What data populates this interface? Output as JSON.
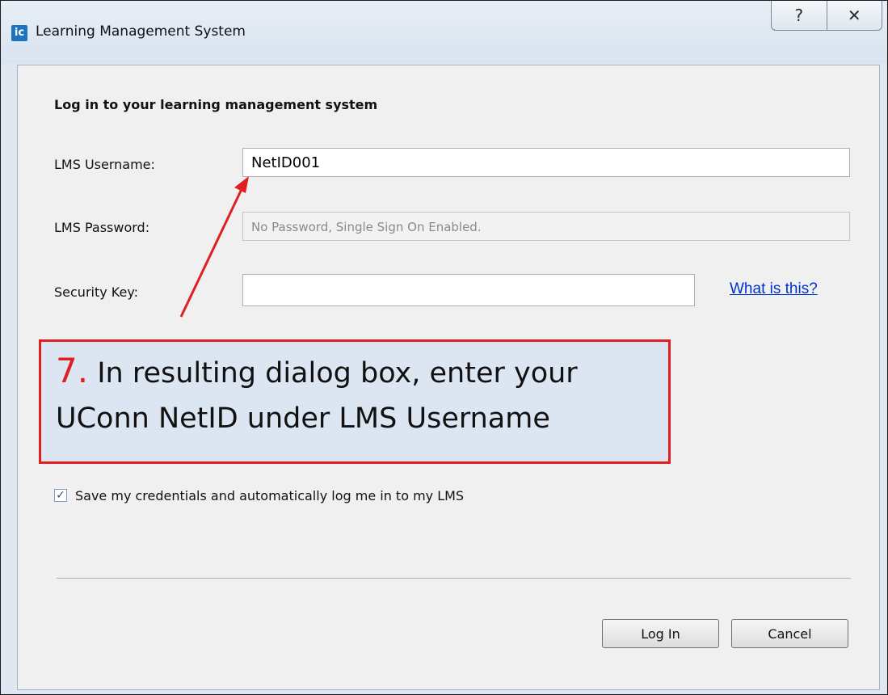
{
  "window": {
    "title": "Learning Management System",
    "app_icon_text": "ic",
    "help_glyph": "?",
    "close_glyph": "✕"
  },
  "form": {
    "heading": "Log in to your learning management system",
    "username_label": "LMS Username:",
    "username_value": "NetID001",
    "password_label": "LMS Password:",
    "password_placeholder": "No Password, Single Sign On Enabled.",
    "security_key_label": "Security Key:",
    "security_key_value": "",
    "what_is_this": "What is this?",
    "save_credentials_label": "Save my credentials and automatically log me in to my LMS",
    "save_credentials_checked": true,
    "login_button": "Log In",
    "cancel_button": "Cancel"
  },
  "callout": {
    "number": "7.",
    "line1": "In resulting dialog box, enter your",
    "line2": "UConn NetID under LMS Username"
  },
  "colors": {
    "callout_border": "#e02020",
    "callout_fill": "#dce6f2",
    "link": "#0033cc"
  }
}
